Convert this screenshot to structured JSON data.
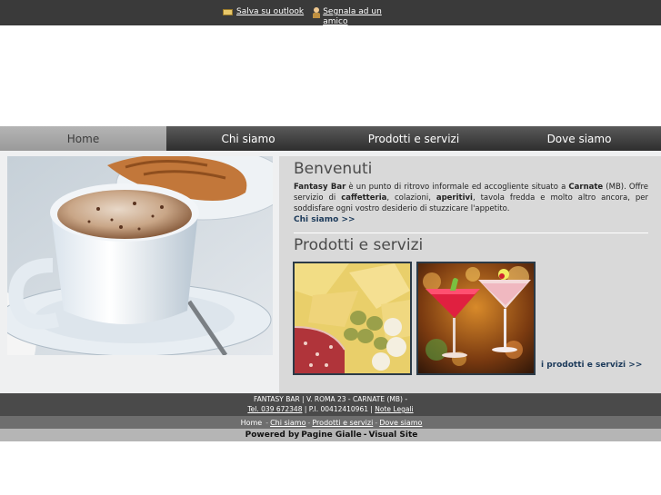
{
  "topbar": {
    "outlook_label": "Salva su outlook",
    "amico_label": "Segnala ad un amico"
  },
  "nav": {
    "items": [
      {
        "label": "Home",
        "active": true
      },
      {
        "label": "Chi siamo",
        "active": false
      },
      {
        "label": "Prodotti e servizi",
        "active": false
      },
      {
        "label": "Dove siamo",
        "active": false
      }
    ]
  },
  "welcome": {
    "title": "Benvenuti",
    "text_parts": {
      "p1": "Fantasy Bar",
      "p2": " è un punto di ritrovo informale ed accogliente situato a ",
      "p3": "Carnate",
      "p4": " (MB). Offre servizio di ",
      "p5": "caffetteria",
      "p6": ", colazioni, ",
      "p7": "aperitivi",
      "p8": ", tavola fredda e molto altro ancora, per soddisfare ogni vostro desiderio di stuzzicare l'appetito."
    },
    "link": "Chi siamo >>"
  },
  "products": {
    "title": "Prodotti e servizi",
    "link": "i prodotti e servizi >>"
  },
  "footer": {
    "line1": "FANTASY BAR | V. ROMA 23 - CARNATE (MB) -",
    "tel": "Tel. 039 672348",
    "piva": " | P.I. 00412410961 | ",
    "legal": "Note Legali"
  },
  "subnav": {
    "home": "Home",
    "chi": "Chi siamo",
    "prod": "Prodotti e servizi",
    "dove": "Dove siamo",
    "separator": "-"
  },
  "powered": {
    "prefix": "Powered by",
    "pg": "Pagine Gialle",
    "dash": "-",
    "vs": "Visual Site"
  },
  "colors": {
    "topbar": "#3a3a3a",
    "nav_active": "#a8a8a8",
    "link": "#1c3a5a"
  }
}
